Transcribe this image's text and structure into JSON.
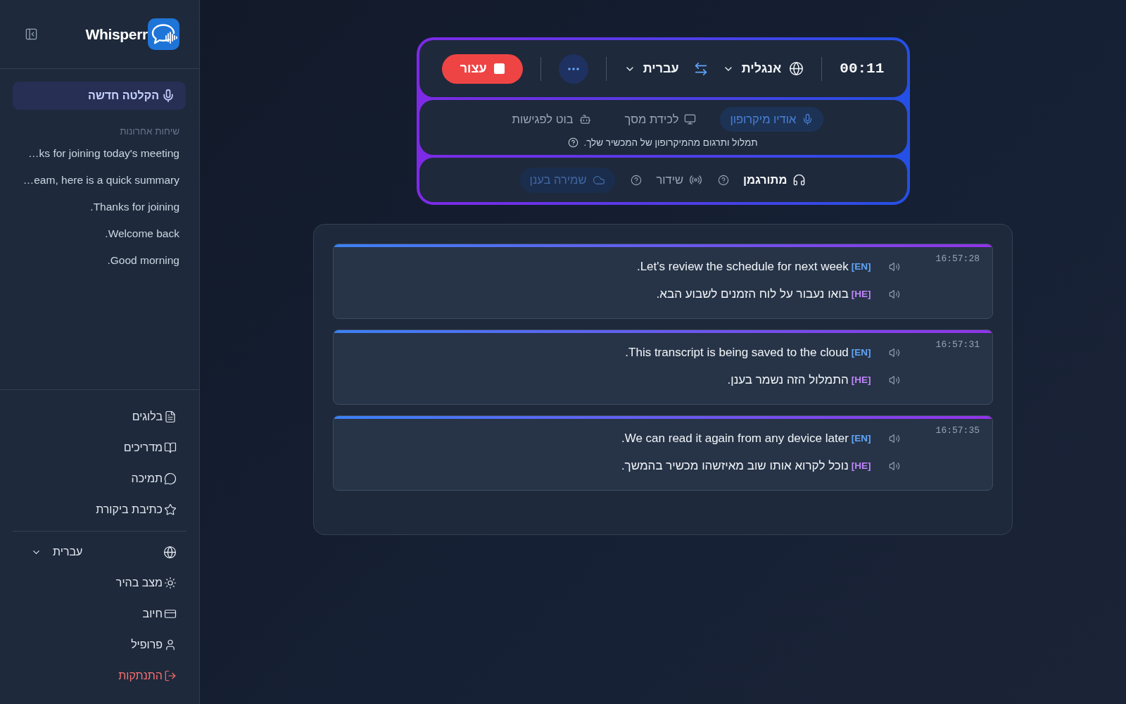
{
  "sidebar": {
    "app_name": "Whisperr",
    "new_recording_button": "הקלטה חדשה",
    "recent_heading": "שיחות אחרונות",
    "recent_conversations": [
      "ks for joining today's meeting…",
      "eam, here is a quick summary…",
      "Thanks for joining.",
      "Welcome back.",
      "Good morning."
    ],
    "nav_links": [
      "בלוגים",
      "מדריכים",
      "תמיכה",
      "כתיבת ביקורת"
    ],
    "language_select": "עברית",
    "settings_links": [
      {
        "label": "מצב בהיר",
        "kind": "link"
      },
      {
        "label": "חיוב",
        "kind": "link"
      },
      {
        "label": "פרופיל",
        "kind": "link"
      },
      {
        "label": "התנתקות",
        "kind": "danger"
      }
    ]
  },
  "recorder": {
    "timer": "00:11",
    "source_language": "אנגלית",
    "target_language": "עברית",
    "stop_button": "עצור",
    "sources": [
      {
        "label": "אודיו מיקרופון",
        "selected": true
      },
      {
        "label": "לכידת מסך",
        "selected": false
      },
      {
        "label": "בוט לפגישות",
        "selected": false
      }
    ],
    "source_hint": "תמלול ותרגום מהמיקרופון של המכשיר שלך.",
    "modes": [
      {
        "label": "מתורגמן",
        "selected": true
      },
      {
        "label": "שידור",
        "selected": false
      }
    ],
    "cloud_save": {
      "label": "שמירה בענן",
      "on": true
    }
  },
  "transcript": {
    "entries": [
      {
        "time": "16:57:28",
        "lines": [
          {
            "tag": "[EN]",
            "color": "#60a5fa",
            "text": "Let's review the schedule for next week."
          },
          {
            "tag": "[HE]",
            "color": "#c084fc",
            "text": "בואו נעבור על לוח הזמנים לשבוע הבא."
          }
        ]
      },
      {
        "time": "16:57:31",
        "lines": [
          {
            "tag": "[EN]",
            "color": "#60a5fa",
            "text": "This transcript is being saved to the cloud."
          },
          {
            "tag": "[HE]",
            "color": "#c084fc",
            "text": "התמלול הזה נשמר בענן."
          }
        ]
      },
      {
        "time": "16:57:35",
        "lines": [
          {
            "tag": "[EN]",
            "color": "#60a5fa",
            "text": "We can read it again from any device later."
          },
          {
            "tag": "[HE]",
            "color": "#c084fc",
            "text": "נוכל לקרוא אותו שוב מאיזשהו מכשיר בהמשך."
          }
        ]
      }
    ]
  }
}
